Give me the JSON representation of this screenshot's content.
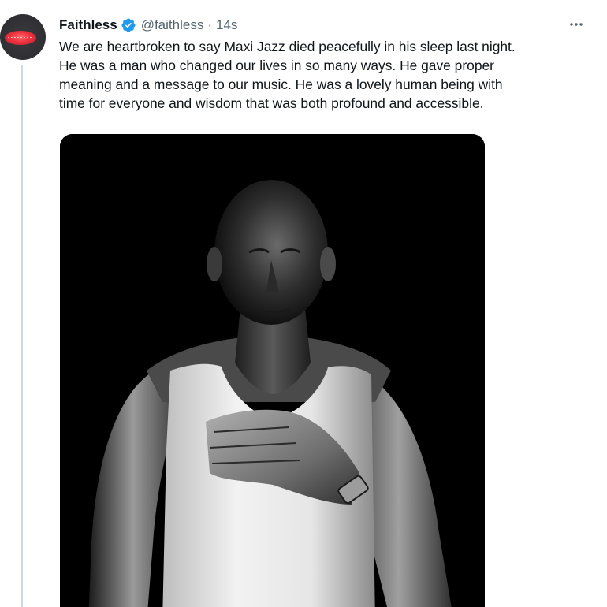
{
  "tweet": {
    "author": {
      "display_name": "Faithless",
      "handle": "@faithless",
      "verified": true,
      "avatar_icon": "red-vinyl-record-logo"
    },
    "separator": "·",
    "timestamp": "14s",
    "more_icon": "more-horizontal-icon",
    "text_lines": [
      "We are heartbroken to say Maxi Jazz died peacefully in his sleep last night.",
      "He was a man who changed our lives in so many ways. He gave proper",
      "meaning and a message to our music. He was a lovely human being with",
      "time for everyone and wisdom that was both profound and accessible."
    ],
    "media": {
      "type": "photo",
      "description_icon": "black-and-white-portrait"
    }
  },
  "colors": {
    "text_primary": "#0f1419",
    "text_secondary": "#536471",
    "verified_blue": "#1d9bf0",
    "thread_line": "#cfd9de",
    "avatar_red": "#ef3340"
  }
}
